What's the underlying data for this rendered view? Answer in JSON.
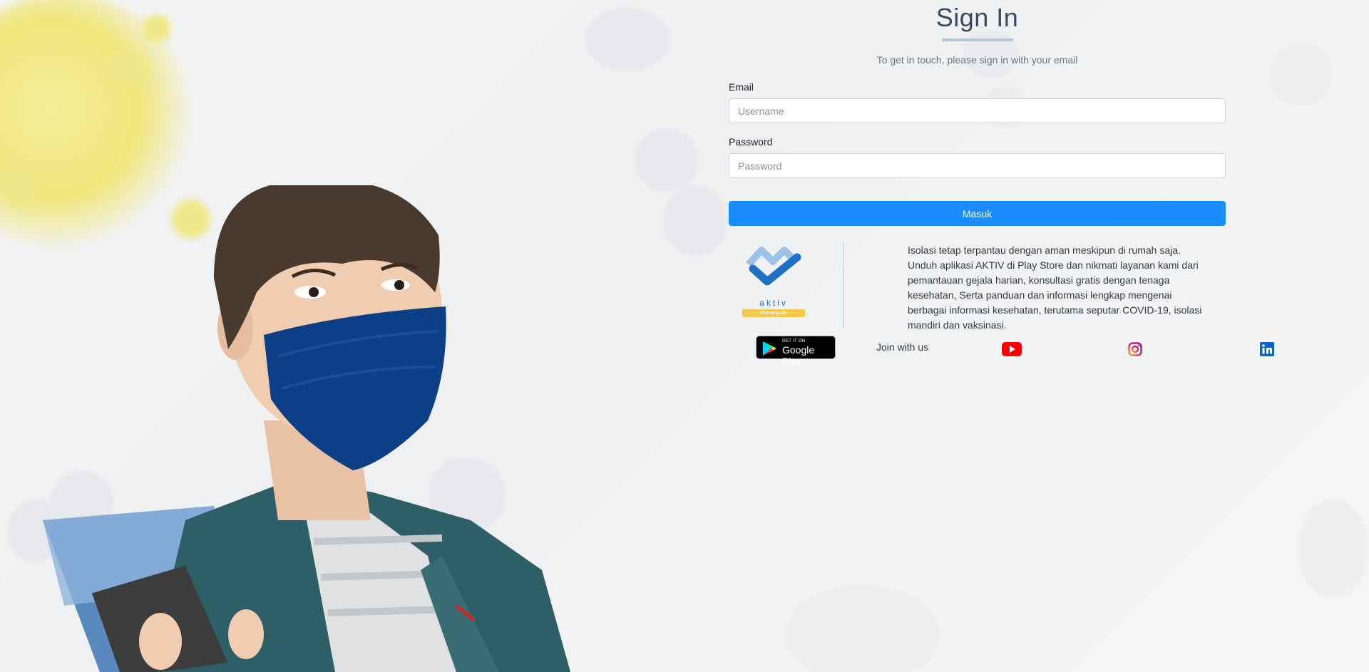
{
  "form": {
    "title": "Sign In",
    "subtitle": "To get in touch, please sign in with your email",
    "email_label": "Email",
    "email_placeholder": "Username",
    "password_label": "Password",
    "password_placeholder": "Password",
    "submit_label": "Masuk"
  },
  "promo": {
    "logo_text": "aktiv",
    "logo_tagline": "#temanpulih",
    "description": "Isolasi tetap terpantau dengan aman meskipun di rumah saja. Unduh aplikasi AKTIV di Play Store dan nikmati layanan kami dari pemantauan gejala harian, konsultasi gratis dengan tenaga kesehatan, Serta panduan dan informasi lengkap mengenai berbagai informasi kesehatan, terutama seputar COVID-19, isolasi mandiri dan vaksinasi."
  },
  "social": {
    "google_play_small": "GET IT ON",
    "google_play_big": "Google Play",
    "join_label": "Join with us",
    "icons": [
      "youtube-icon",
      "instagram-icon",
      "linkedin-icon"
    ]
  },
  "colors": {
    "primary_button": "#1a8cff",
    "title": "#3b4a5f",
    "youtube": "#ff0000",
    "linkedin": "#0a66c2"
  }
}
